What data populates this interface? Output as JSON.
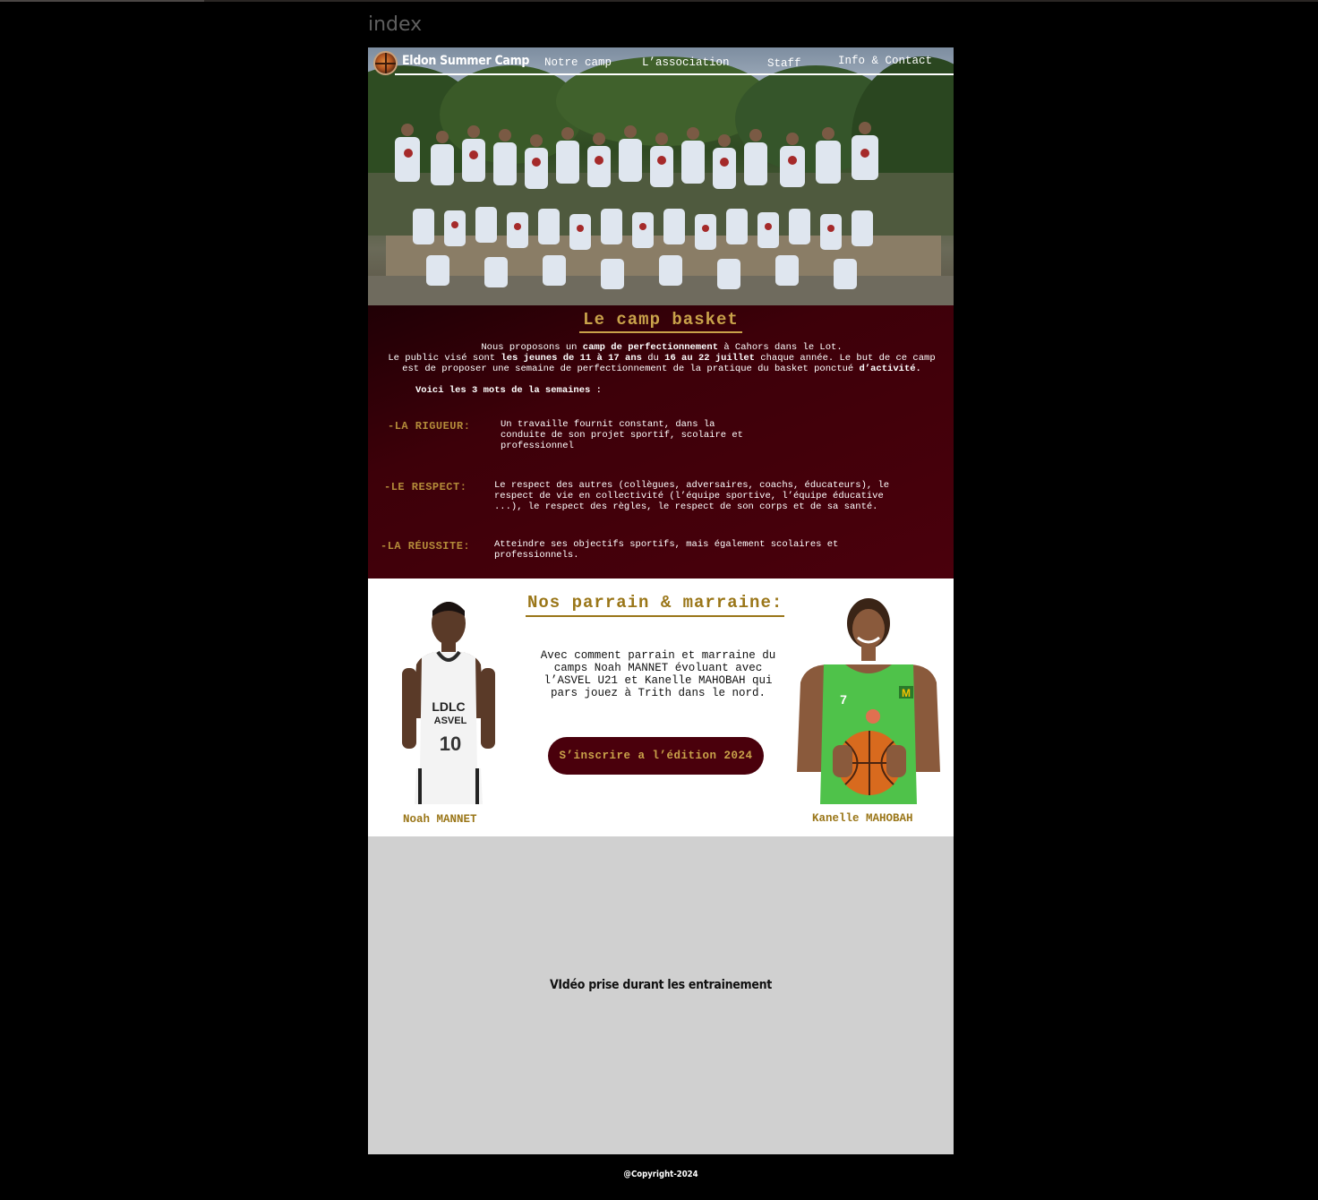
{
  "window": {
    "title": "index"
  },
  "nav": {
    "brand": "Eldon Summer Camp",
    "links": [
      "Notre camp",
      "L’association",
      "Staff",
      "Info & Contact"
    ]
  },
  "camp": {
    "title": "Le camp basket",
    "intro": {
      "line1_pre": "Nous proposons un ",
      "line1_bold": "camp de perfectionnement",
      "line1_post": " à Cahors dans le Lot.",
      "line2_pre": "Le public visé sont ",
      "line2_bold1": "les jeunes de 11 à 17 ans",
      "line2_mid": " du ",
      "line2_bold2": "16 au 22 juillet",
      "line2_post": " chaque année. Le but de ce camp",
      "line3_pre": "est de proposer une semaine de perfectionnement de la pratique du basket ponctué ",
      "line3_bold": "d’activité."
    },
    "words_heading": "Voici les 3 mots de la semaines :",
    "words": [
      {
        "label": "-LA RIGUEUR:",
        "text": "Un travaille fournit constant, dans la conduite de son projet sportif, scolaire et professionnel"
      },
      {
        "label": "-LE RESPECT:",
        "text": "Le respect des autres (collègues, adversaires, coachs, éducateurs), le respect de vie en collectivité (l’équipe sportive, l’équipe éducative ...), le respect des règles, le respect de son corps et de sa santé."
      },
      {
        "label": "-LA RÉUSSITE:",
        "text": "Atteindre ses objectifs sportifs, mais également scolaires et professionnels."
      }
    ]
  },
  "sponsors": {
    "title": "Nos parrain & marraine:",
    "text": "Avec comment parrain et marraine du camps Noah MANNET évoluant avec l’ASVEL U21 et Kanelle MAHOBAH qui pars jouez à Trith dans le nord.",
    "cta": "S’inscrire a l’édition 2024",
    "left_player": {
      "name": "Noah MANNET",
      "jersey_brand": "LDLC",
      "jersey_team": "ASVEL",
      "jersey_number": "10"
    },
    "right_player": {
      "name": "Kanelle MAHOBAH",
      "jersey_number": "7"
    }
  },
  "video": {
    "label": "VIdéo prise durant les entrainement"
  },
  "footer": {
    "text": "@Copyright-2024"
  },
  "colors": {
    "burgundy": "#4a000c",
    "gold": "#c9a24a",
    "gold_dark": "#9a7618",
    "video_bg": "#d0d0d0"
  }
}
